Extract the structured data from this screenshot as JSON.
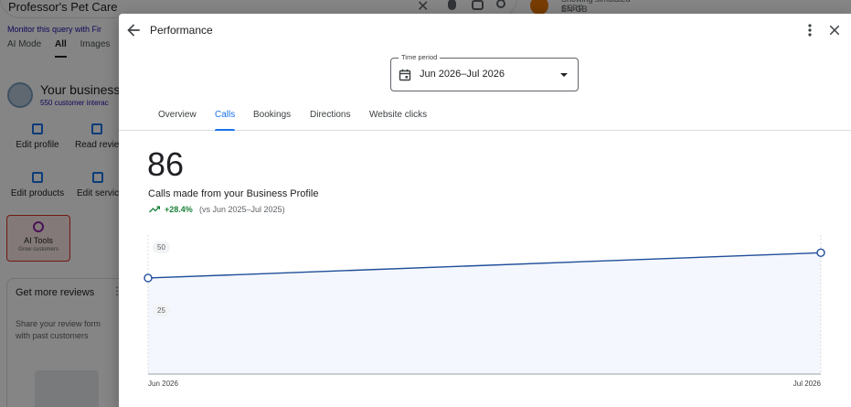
{
  "background": {
    "search_query": "Professor's Pet Care",
    "simulated_line1": "Showing simulated SERP",
    "simulated_line2": "EN-GB",
    "monitor_text": "Monitor this query with Fir",
    "tabs": [
      "AI Mode",
      "All",
      "Images"
    ],
    "business_title": "Your business",
    "business_sub": "550 customer interac",
    "actions": [
      "Edit profile",
      "Read revie",
      "Edit products",
      "Edit servic"
    ],
    "ai_tools_label": "AI Tools",
    "ai_tools_sub": "Grow customers",
    "card_title": "Get more reviews",
    "card_text": "Share your review form with past customers"
  },
  "dialog": {
    "title": "Performance",
    "time_period": {
      "legend": "Time period",
      "value": "Jun 2026–Jul 2026"
    },
    "tabs": [
      {
        "label": "Overview",
        "active": false
      },
      {
        "label": "Calls",
        "active": true
      },
      {
        "label": "Bookings",
        "active": false
      },
      {
        "label": "Directions",
        "active": false
      },
      {
        "label": "Website clicks",
        "active": false
      }
    ],
    "metric": {
      "value": "86",
      "label": "Calls made from your Business Profile",
      "change": "+28.4%",
      "comparison": "(vs Jun 2025–Jul 2025)"
    }
  },
  "chart_data": {
    "type": "area",
    "x": [
      "Jun 2026",
      "Jul 2026"
    ],
    "values": [
      38,
      48
    ],
    "y_ticks": [
      25,
      50
    ],
    "ylim": [
      0,
      55
    ],
    "line_color": "#1f4e9a",
    "fill_color": "#f4f7fd"
  }
}
